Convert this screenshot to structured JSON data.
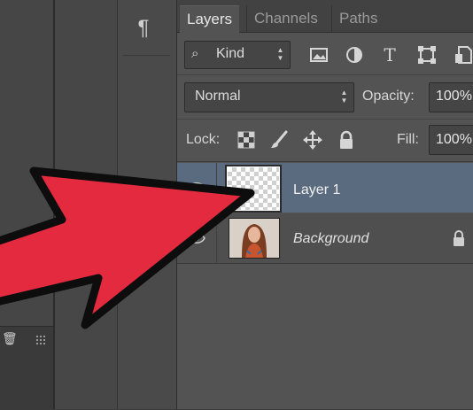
{
  "tabs": [
    "Layers",
    "Channels",
    "Paths"
  ],
  "filter": {
    "kind_label": "Kind",
    "icons": [
      "image-filter-icon",
      "adjustment-filter-icon",
      "type-filter-icon",
      "shape-filter-icon",
      "smart-object-filter-icon"
    ]
  },
  "blend": {
    "mode": "Normal",
    "opacity_label": "Opacity:",
    "opacity_value": "100%"
  },
  "lock": {
    "label": "Lock:",
    "fill_label": "Fill:",
    "fill_value": "100%"
  },
  "layers": [
    {
      "name": "Layer 1",
      "selected": true
    },
    {
      "name": "Background",
      "locked": true
    }
  ],
  "colors": {
    "arrow": "#e32a3f",
    "selection": "#5b6b7f",
    "panel": "#535353"
  }
}
